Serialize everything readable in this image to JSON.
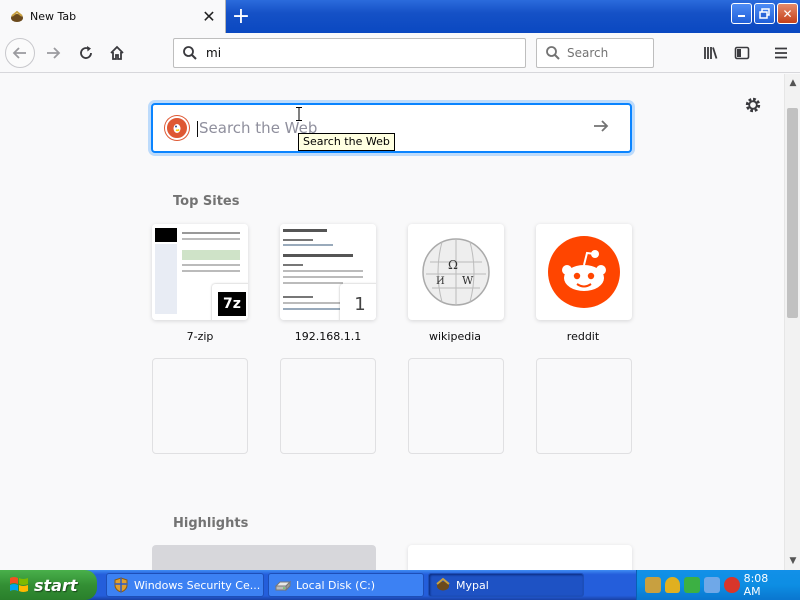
{
  "browser": {
    "tab_title": "New Tab",
    "url_value": "mi",
    "search_placeholder": "Search"
  },
  "newtab": {
    "web_search_placeholder": "Search the Web",
    "tooltip": "Search the Web",
    "top_sites_title": "Top Sites",
    "highlights_title": "Highlights",
    "top_sites": [
      {
        "label": "7-zip",
        "badge": "7z"
      },
      {
        "label": "192.168.1.1",
        "badge": "1"
      },
      {
        "label": "wikipedia"
      },
      {
        "label": "reddit"
      }
    ]
  },
  "taskbar": {
    "start_label": "start",
    "items": [
      {
        "label": "Windows Security Ce..."
      },
      {
        "label": "Local Disk (C:)"
      },
      {
        "label": "Mypal"
      }
    ],
    "clock": "8:08 AM"
  },
  "colors": {
    "accent": "#0a84ff",
    "reddit": "#ff4500",
    "duckduckgo": "#de5833",
    "xp_taskbar": "#245edb",
    "xp_start": "#338f34"
  }
}
